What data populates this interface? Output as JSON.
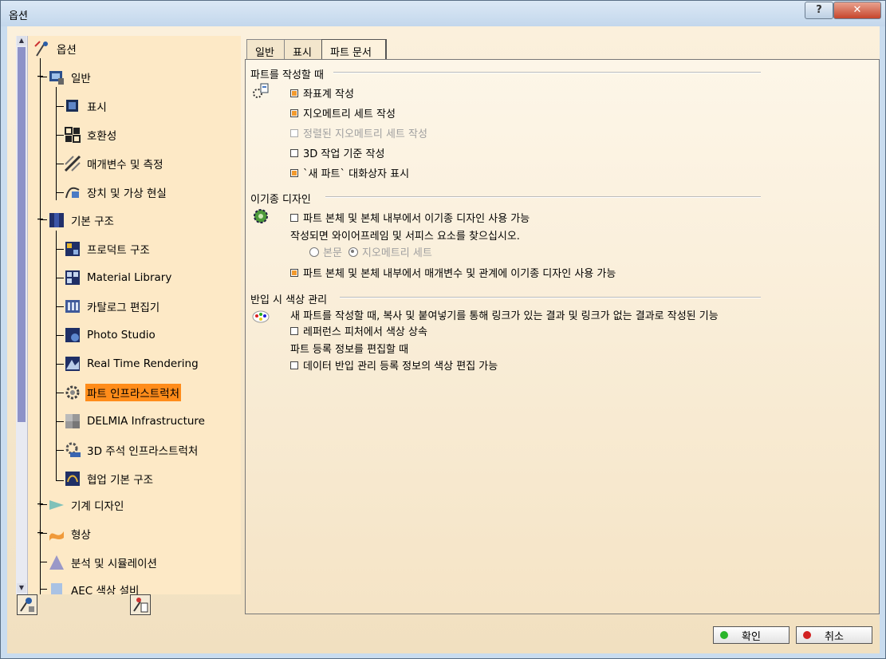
{
  "window": {
    "title": "옵션",
    "help_glyph": "?",
    "close_glyph": "✕"
  },
  "tree": {
    "items": [
      {
        "label": "옵션",
        "icon": "options-tree-icon"
      },
      {
        "label": "일반",
        "icon": "general-icon"
      },
      {
        "label": "표시",
        "icon": "display-icon"
      },
      {
        "label": "호환성",
        "icon": "compatibility-icon"
      },
      {
        "label": "매개변수 및 측정",
        "icon": "parameters-icon"
      },
      {
        "label": "장치 및 가상 현실",
        "icon": "devices-vr-icon"
      },
      {
        "label": "기본 구조",
        "icon": "infrastructure-icon"
      },
      {
        "label": "프로덕트 구조",
        "icon": "product-structure-icon"
      },
      {
        "label": "Material Library",
        "icon": "material-library-icon"
      },
      {
        "label": "카탈로그 편집기",
        "icon": "catalog-editor-icon"
      },
      {
        "label": "Photo Studio",
        "icon": "photo-studio-icon"
      },
      {
        "label": "Real Time Rendering",
        "icon": "real-time-rendering-icon"
      },
      {
        "label": "파트 인프라스트럭처",
        "icon": "part-infrastructure-icon"
      },
      {
        "label": "DELMIA Infrastructure",
        "icon": "delmia-icon"
      },
      {
        "label": "3D 주석 인프라스트럭처",
        "icon": "annotation-icon"
      },
      {
        "label": "협업 기본 구조",
        "icon": "collaboration-icon"
      },
      {
        "label": "기계 디자인",
        "icon": "mechanical-design-icon"
      },
      {
        "label": "형상",
        "icon": "shape-icon"
      },
      {
        "label": "분석 및 시뮬레이션",
        "icon": "analysis-icon"
      },
      {
        "label": "AEC 색상 설비",
        "icon": "aec-icon"
      }
    ],
    "scroll_up": "▲",
    "scroll_down": "▼"
  },
  "tabs": [
    {
      "label": "일반"
    },
    {
      "label": "표시"
    },
    {
      "label": "파트 문서"
    }
  ],
  "sections": {
    "create": {
      "title": "파트를 작성할 때",
      "options": [
        {
          "label": "좌표계 작성",
          "checked": true
        },
        {
          "label": "지오메트리 세트 작성",
          "checked": true
        },
        {
          "label": "정렬된 지오메트리 세트 작성",
          "checked": false
        },
        {
          "label": "3D 작업 기준 작성",
          "checked": false
        },
        {
          "label": "`새 파트` 대화상자 표시",
          "checked": true
        }
      ]
    },
    "hybrid": {
      "title": "이기종 디자인",
      "option1": "파트 본체 및 본체 내부에서 이기종 디자인 사용 가능",
      "info": "작성되면 와이어프레임 및 서피스 요소를 찾으십시오.",
      "radio_body": "본문",
      "radio_geoset": "지오메트리 세트",
      "option2": "파트 본체 및 본체 내부에서 매개변수 및 관계에 이기종 디자인 사용 가능"
    },
    "color": {
      "title": "반입 시 색상 관리",
      "desc": "새 파트를 작성할 때, 복사 및 붙여넣기를 통해 링크가 있는 결과 및 링크가 없는 결과로 작성된 기능",
      "inherit": "레퍼런스 피처에서 색상 상속",
      "edit_heading": "파트 등록 정보를 편집할 때",
      "edit_option": "데이터 반입 관리 등록 정보의 색상 편집 가능"
    }
  },
  "buttons": {
    "ok": "확인",
    "cancel": "취소"
  },
  "colors": {
    "selection": "#ff8c1a",
    "checkbox_fill": "#f29a2e",
    "ok_dot": "#2ab52a",
    "cancel_dot": "#d22222"
  }
}
